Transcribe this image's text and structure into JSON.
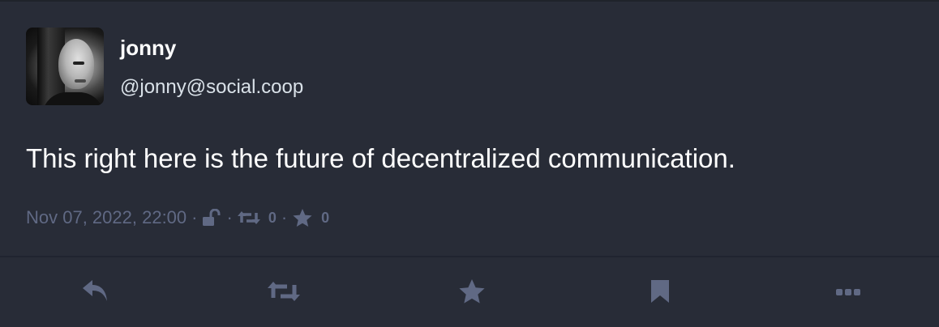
{
  "status": {
    "author": {
      "display_name": "jonny",
      "handle": "@jonny@social.coop"
    },
    "content": "This right here is the future of decentralized communication.",
    "meta": {
      "timestamp": "Nov 07, 2022, 22:00",
      "separator": "·",
      "visibility_icon": "unlock-icon",
      "boosts_count": "0",
      "favourites_count": "0"
    }
  },
  "actions": [
    {
      "name": "reply",
      "icon": "reply-icon"
    },
    {
      "name": "boost",
      "icon": "retweet-icon"
    },
    {
      "name": "favourite",
      "icon": "star-icon"
    },
    {
      "name": "bookmark",
      "icon": "bookmark-icon"
    },
    {
      "name": "more",
      "icon": "ellipsis-icon"
    }
  ],
  "colors": {
    "background": "#282c37",
    "text_primary": "#ffffff",
    "text_secondary": "#d9e1e8",
    "muted": "#606984",
    "divider": "#202430"
  }
}
